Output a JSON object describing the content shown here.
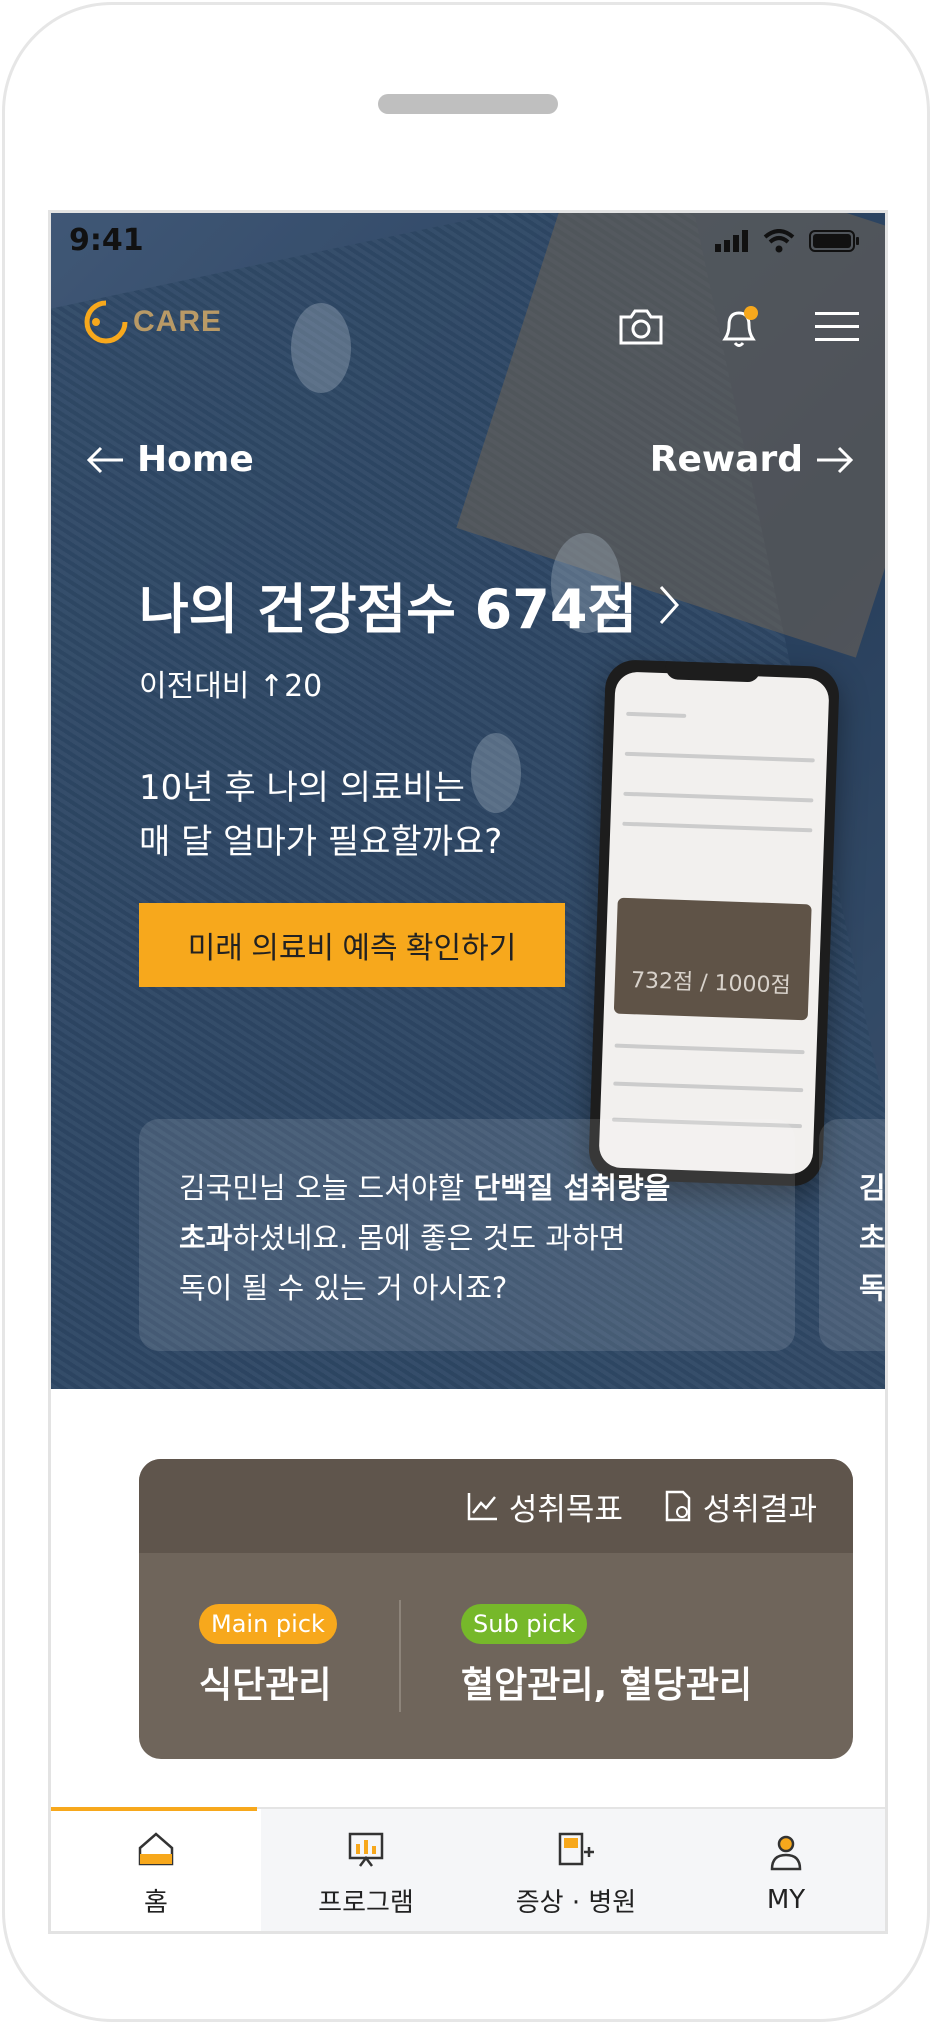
{
  "status_bar": {
    "time": "9:41"
  },
  "header": {
    "logo_text": "CARE",
    "camera_icon": "camera-icon",
    "bell_icon": "bell-icon",
    "menu_icon": "menu-icon"
  },
  "nav": {
    "home_label": "Home",
    "reward_label": "Reward"
  },
  "score": {
    "title": "나의 건강점수 674점",
    "compare": "이전대비 ↑20",
    "question_line1": "10년 후 나의 의료비는",
    "question_line2": "매 달 얼마가 필요할까요?",
    "cta_label": "미래 의료비 예측 확인하기"
  },
  "message": {
    "line1_pre": "김국민님 오늘 드셔야할 ",
    "line1_bold": "단백질 섭취량을",
    "line2_bold": "초과",
    "line2_rest": "하셨네요. 몸에 좋은 것도 과하면",
    "line3": "독이 될 수 있는 거 아시죠?",
    "next_preview": "김\n초\n독"
  },
  "achievement": {
    "goal_label": "성취목표",
    "result_label": "성취결과",
    "main_badge": "Main pick",
    "main_value": "식단관리",
    "sub_badge": "Sub pick",
    "sub_value": "혈압관리, 혈당관리"
  },
  "tabs": [
    {
      "label": "홈",
      "icon": "home-icon"
    },
    {
      "label": "프로그램",
      "icon": "program-icon"
    },
    {
      "label": "증상 · 병원",
      "icon": "hospital-icon"
    },
    {
      "label": "MY",
      "icon": "user-icon"
    }
  ],
  "colors": {
    "accent": "#f7a81c",
    "sub_green": "#76b82a",
    "panel": "#6f655b"
  }
}
